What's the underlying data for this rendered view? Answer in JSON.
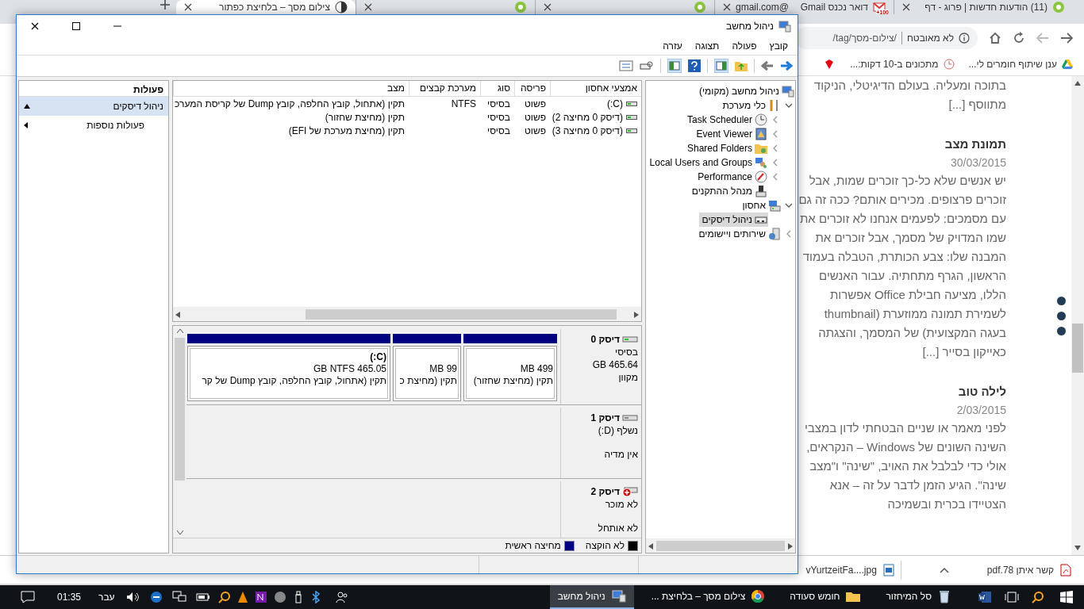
{
  "browser": {
    "tabs": [
      {
        "title": "(11) הודעות חדשות | פרוג - דף",
        "selected": false
      },
      {
        "title": "דואר נכנס Gmail",
        "detail": "@gmail.com",
        "badge": "100+",
        "selected": false
      },
      {
        "selected": false
      },
      {
        "selected": false
      },
      {
        "title": "צילום מסך – בלחיצת כפתור",
        "selected": true
      }
    ],
    "security": "לא מאובטח",
    "url": "/tag/צילום-מסך/",
    "bookmarks": [
      "ענן שיתוף חומרים לי...",
      "מתכונים ב-10 דקות:..."
    ]
  },
  "blog": {
    "posts": [
      {
        "excerpt": "בתוכה ומעליה. בעולם הדיגיטלי, הניקוד מתווסף [...]"
      },
      {
        "title": "תמונת מצב",
        "date": "30/03/2015",
        "excerpt": "יש אנשים שלא כל-כך זוכרים שמות, אבל זוכרים פרצופים. מכירים אותם? ככה זה גם עם מסמכים: לפעמים אנחנו לא זוכרים את שמו המדויק של מסמך, אבל זוכרים את המבנה שלו: צבע הכותרת, הטבלה בעמוד הראשון, הגרף מתחתיה. עבור האנשים הללו, מציעה חבילת Office אפשרות לשמירת תמונה ממוזערת (thumbnail בעגה המקצועית) של המסמך, והצגתה כאייקון בסייר [...]"
      },
      {
        "title": "לילה טוב",
        "date": "2/03/2015",
        "excerpt": "לפני מאמר או שניים הבטחתי לדון במצבי השינה השונים של Windows – הנקראים, אולי כדי לבלבל את האויב, \"שינה\" ו\"מצב שינה\". הגיע הזמן לדבר על זה – אנא הצטיידו בכרית ובשמיכה"
      }
    ]
  },
  "downloads": [
    "קשר איתן 78.pdf",
    "vYurtzeitFa....jpg"
  ],
  "taskbar": {
    "apps": [
      {
        "label": "סל המיחזור",
        "selected": false
      },
      {
        "label": "חומש סעודה",
        "selected": false
      },
      {
        "label": "צילום מסך – בלחיצת ...",
        "selected": false
      },
      {
        "label": "ניהול מחשב",
        "selected": true
      }
    ],
    "language": "עבר",
    "time": "01:35"
  },
  "window": {
    "title": "ניהול מחשב",
    "menu": [
      "קובץ",
      "פעולה",
      "תצוגה",
      "עזרה"
    ],
    "tree": [
      {
        "label": "ניהול מחשב (מקומי)",
        "selected": false,
        "children": [
          {
            "label": "כלי מערכת",
            "expanded": true,
            "selected": false,
            "children": [
              {
                "label": "Task Scheduler",
                "expanded": false,
                "selected": false
              },
              {
                "label": "Event Viewer",
                "expanded": false,
                "selected": false
              },
              {
                "label": "Shared Folders",
                "expanded": false,
                "selected": false
              },
              {
                "label": "Local Users and Groups",
                "expanded": false,
                "selected": false
              },
              {
                "label": "Performance",
                "expanded": false,
                "selected": false
              },
              {
                "label": "מנהל ההתקנים",
                "selected": false
              }
            ]
          },
          {
            "label": "אחסון",
            "expanded": true,
            "selected": false,
            "children": [
              {
                "label": "ניהול דיסקים",
                "selected": true
              }
            ]
          },
          {
            "label": "שירותים ויישומים",
            "expanded": false,
            "selected": false
          }
        ]
      }
    ],
    "volumes": {
      "columns": [
        "אמצעי אחסון",
        "פריסה",
        "סוג",
        "מערכת קבצים",
        "מצב"
      ],
      "rows": [
        [
          "(C:)",
          "פשוט",
          "בסיסי",
          "NTFS",
          "תקין (אתחול, קובץ החלפה, קובץ Dump של קריסת המערכ"
        ],
        [
          "(דיסק 0 מחיצה 2)",
          "פשוט",
          "בסיסי",
          "",
          "תקין (מחיצת שחזור)"
        ],
        [
          "(דיסק 0 מחיצה 3)",
          "פשוט",
          "בסיסי",
          "",
          "תקין (מחיצת מערכת של EFI)"
        ]
      ]
    },
    "disks": [
      {
        "name": "דיסק 0",
        "kind": "online",
        "type": "בסיסי",
        "size": "GB 465.64",
        "state": "מקוון",
        "partitions": [
          {
            "size": "MB 499",
            "status": "תקין (מחיצת שחזור)"
          },
          {
            "size": "MB 99",
            "status": "תקין (מחיצת כ"
          },
          {
            "label": "(C:)",
            "size": "GB NTFS 465.05",
            "status": "תקין (אתחול, קובץ החלפה, קובץ Dump של קר"
          }
        ]
      },
      {
        "name": "דיסק 1",
        "kind": "removable",
        "type": "נשלף (D:)",
        "state": "אין מדיה"
      },
      {
        "name": "דיסק 2",
        "kind": "error",
        "type": "לא מוכר",
        "state": "לא אותחל"
      }
    ],
    "legend": [
      {
        "label": "לא הוקצה",
        "color": "#000000"
      },
      {
        "label": "מחיצה ראשית",
        "color": "#000080"
      }
    ],
    "actions": {
      "title": "פעולות",
      "items": [
        {
          "label": "ניהול דיסקים",
          "kind": "section",
          "selected": true
        },
        {
          "label": "פעולות נוספות",
          "kind": "submenu",
          "selected": false
        }
      ]
    }
  }
}
